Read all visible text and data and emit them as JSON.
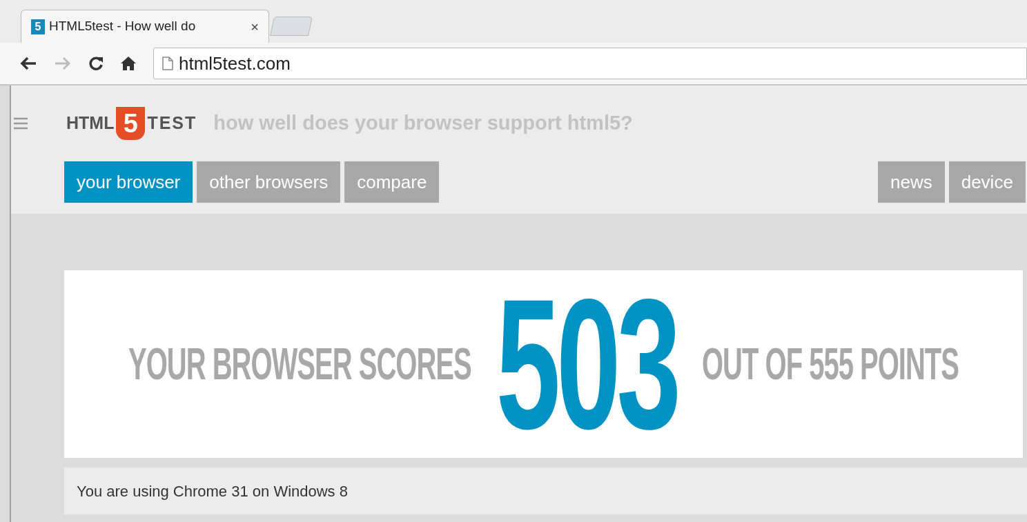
{
  "browser": {
    "tab": {
      "favicon": "5",
      "title": "HTML5test - How well do",
      "close": "×"
    },
    "address": "html5test.com"
  },
  "site": {
    "logo": {
      "left": "HTML",
      "badge": "5",
      "right": "TEST"
    },
    "tagline": "how well does your browser support html5?",
    "nav_left": [
      {
        "label": "your browser",
        "selected": true
      },
      {
        "label": "other browsers",
        "selected": false
      },
      {
        "label": "compare",
        "selected": false
      }
    ],
    "nav_right": [
      {
        "label": "news",
        "selected": false
      },
      {
        "label": "device",
        "selected": false
      }
    ]
  },
  "score": {
    "before": "YOUR BROWSER SCORES",
    "value": "503",
    "after": "OUT OF 555 POINTS"
  },
  "info": "You are using Chrome 31 on Windows 8"
}
